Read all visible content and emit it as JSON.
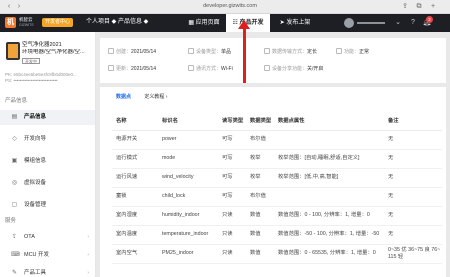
{
  "browser": {
    "url": "developer.gizwits.com"
  },
  "header": {
    "logo_mark": "机",
    "logo_line1": "机智云",
    "logo_line2": "GIZWITS",
    "dev_badge": "开发者中心",
    "project": "个人项目 ◆  产品信息 ◆",
    "tabs": [
      {
        "label": "应用页面",
        "active": false
      },
      {
        "label": "产品开发",
        "active": true
      },
      {
        "label": "发布上架",
        "active": false
      }
    ],
    "notification_count": "2",
    "annotation_arrow_color": "#e01e1e"
  },
  "sidebar": {
    "product_name_line1": "空气净化器2021",
    "product_name_line2": "环境电器/空气净化器/空...",
    "product_tag": "开发中",
    "product_key": "PK: e5bc4ee5be5e4fc8fb0d000e0...",
    "product_secret": "PS: ••••••••••••••••••••••••••••",
    "section_info": "产品信息",
    "section_service": "服务",
    "items": [
      {
        "label": "产品信息",
        "icon": "list-icon",
        "active": true
      },
      {
        "label": "开发向导",
        "icon": "guide-icon",
        "active": false
      },
      {
        "label": "模组信息",
        "icon": "chip-icon",
        "active": false
      },
      {
        "label": "虚拟设备",
        "icon": "device-icon",
        "active": false
      },
      {
        "label": "设备管理",
        "icon": "manage-icon",
        "active": false
      }
    ],
    "service_items": [
      {
        "label": "OTA",
        "icon": "upload-icon"
      },
      {
        "label": "MCU 开发",
        "icon": "code-icon"
      },
      {
        "label": "产品工具",
        "icon": "tool-icon"
      }
    ]
  },
  "info": {
    "created_label": "创建：",
    "created": "2021/05/14",
    "updated_label": "更新：",
    "updated": "2021/05/14",
    "type_label": "设备类型：",
    "type": "单品",
    "comm_label": "通讯方式：",
    "comm": "Wi-Fi",
    "data_label": "数据传输方式：",
    "data": "定长",
    "share_label": "设备分享功能：",
    "share": "关/开启",
    "status_label": "功能：",
    "status": "正常"
  },
  "content": {
    "tabs": [
      {
        "label": "数据点",
        "active": true
      },
      {
        "label": "定义教程 ›",
        "active": false
      }
    ],
    "columns": [
      "名称",
      "标识名",
      "读写类型",
      "数据类型",
      "数据点属性",
      "备注"
    ],
    "rows": [
      [
        "电源开关",
        "power",
        "可写",
        "布尔值",
        "",
        "无"
      ],
      [
        "运行模式",
        "mode",
        "可写",
        "枚举",
        "枚举范围：[自动,睡眠,舒适,自定义]",
        "无"
      ],
      [
        "运行风速",
        "wind_velocity",
        "可写",
        "枚举",
        "枚举范围：[低,中,高,智能]",
        "无"
      ],
      [
        "童锁",
        "child_lock",
        "可写",
        "布尔值",
        "",
        "无"
      ],
      [
        "室内湿度",
        "humidity_indoor",
        "只读",
        "数值",
        "数值范围：0 - 100, 分辨率：1, 增量：0",
        "无"
      ],
      [
        "室内温度",
        "temperature_indoor",
        "只读",
        "数值",
        "数值范围：-50 - 100, 分辨率：1, 增量：-50",
        "无"
      ],
      [
        "室内空气",
        "PM25_indoor",
        "只读",
        "数值",
        "数值范围：0 - 65535, 分辨率：1, 增量：0",
        "0~35 优 36~75 良 76~115 轻"
      ]
    ]
  }
}
